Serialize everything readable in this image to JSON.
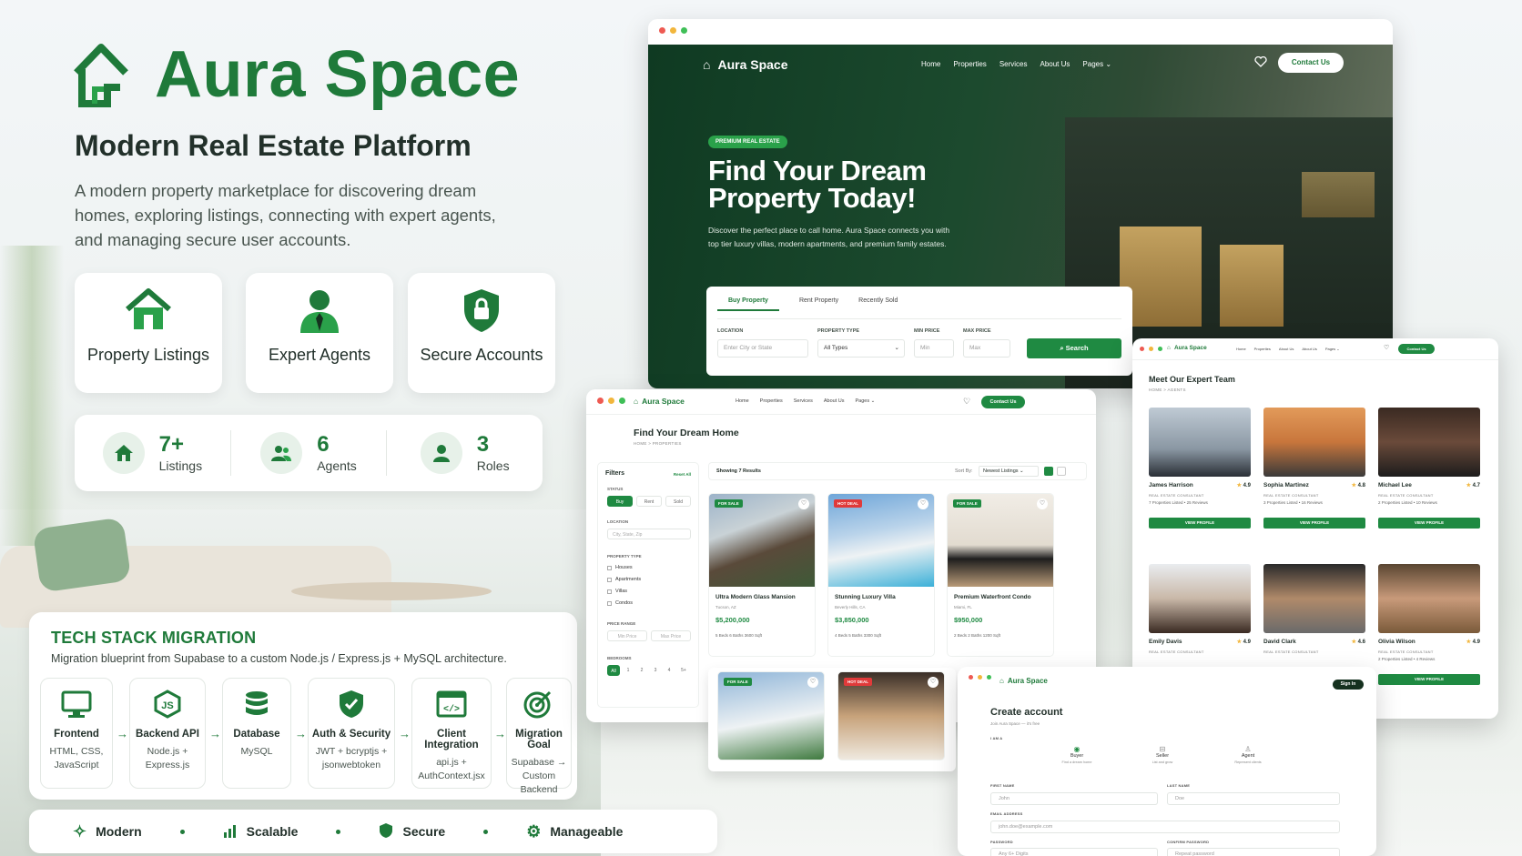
{
  "brand": {
    "name": "Aura Space",
    "tagline": "Modern Real Estate Platform",
    "description": "A modern property marketplace for discovering dream homes, exploring listings, connecting with expert agents, and managing secure user accounts.",
    "accent": "#1f7a3a"
  },
  "features": [
    {
      "label": "Property Listings",
      "icon": "house-icon"
    },
    {
      "label": "Expert Agents",
      "icon": "agent-icon"
    },
    {
      "label": "Secure Accounts",
      "icon": "shield-lock-icon"
    }
  ],
  "stats": [
    {
      "value": "7+",
      "label": "Listings",
      "icon": "home-icon"
    },
    {
      "value": "6",
      "label": "Agents",
      "icon": "users-icon"
    },
    {
      "value": "3",
      "label": "Roles",
      "icon": "user-icon"
    }
  ],
  "tech": {
    "title": "TECH STACK MIGRATION",
    "subtitle": "Migration blueprint from Supabase to a custom Node.js / Express.js + MySQL architecture.",
    "steps": [
      {
        "title": "Frontend",
        "desc": "HTML, CSS, JavaScript",
        "icon": "monitor-icon"
      },
      {
        "title": "Backend API",
        "desc": "Node.js + Express.js",
        "icon": "nodejs-icon"
      },
      {
        "title": "Database",
        "desc": "MySQL",
        "icon": "database-icon"
      },
      {
        "title": "Auth & Security",
        "desc": "JWT + bcryptjs + jsonwebtoken",
        "icon": "shield-icon"
      },
      {
        "title": "Client Integration",
        "desc": "api.js + AuthContext.jsx",
        "icon": "code-window-icon"
      },
      {
        "title": "Migration Goal",
        "desc": "Supabase → Custom Backend",
        "icon": "target-icon"
      }
    ]
  },
  "qualities": [
    "Modern",
    "Scalable",
    "Secure",
    "Manageable"
  ],
  "hero_window": {
    "brand": "Aura Space",
    "nav": [
      "Home",
      "Properties",
      "Services",
      "About Us",
      "Pages"
    ],
    "contact": "Contact Us",
    "badge": "PREMIUM REAL ESTATE",
    "headline": "Find Your Dream Property Today!",
    "text": "Discover the perfect place to call home. Aura Space connects you with top tier luxury villas, modern apartments, and premium family estates.",
    "tabs": [
      "Buy Property",
      "Rent Property",
      "Recently Sold"
    ],
    "fields": {
      "location_label": "LOCATION",
      "location_ph": "Enter City or State",
      "type_label": "PROPERTY TYPE",
      "type_value": "All Types",
      "min_label": "MIN PRICE",
      "min_ph": "Min",
      "max_label": "MAX PRICE",
      "max_ph": "Max"
    },
    "search": "Search"
  },
  "listing_window": {
    "brand": "Aura Space",
    "nav": [
      "Home",
      "Properties",
      "Services",
      "About Us",
      "Pages"
    ],
    "contact": "Contact Us",
    "title": "Find Your Dream Home",
    "crumb": "HOME  >  PROPERTIES",
    "filters": "Filters",
    "reset": "Reset All",
    "status_label": "STATUS",
    "status": [
      "Buy",
      "Rent",
      "Sold"
    ],
    "location_label": "LOCATION",
    "location_ph": "City, State, Zip",
    "type_label": "PROPERTY TYPE",
    "types": [
      "Houses",
      "Apartments",
      "Villas",
      "Condos"
    ],
    "price_label": "PRICE RANGE",
    "min_ph": "Min Price",
    "max_ph": "Max Price",
    "bed_label": "BEDROOMS",
    "beds": [
      "All",
      "1",
      "2",
      "3",
      "4",
      "5+"
    ],
    "results": "Showing 7 Results",
    "sort_label": "Sort By:",
    "sort_value": "Newest Listings",
    "cards": [
      {
        "tag": "FOR SALE",
        "name": "Ultra Modern Glass Mansion",
        "loc": "Tucson, AZ",
        "price": "$5,200,000",
        "feats": "5 Beds   6 Baths   3600 Sqft"
      },
      {
        "tag": "HOT DEAL",
        "name": "Stunning Luxury Villa",
        "loc": "Beverly Hills, CA",
        "price": "$3,850,000",
        "feats": "4 Beds   5 Baths   3300 Sqft"
      },
      {
        "tag": "FOR SALE",
        "name": "Premium Waterfront Condo",
        "loc": "Miami, FL",
        "price": "$950,000",
        "feats": "2 Beds   2 Baths   1200 Sqft"
      }
    ],
    "cards_row2": [
      {
        "tag": "FOR SALE"
      },
      {
        "tag": "HOT DEAL"
      }
    ]
  },
  "team_window": {
    "brand": "Aura Space",
    "nav": [
      "Home",
      "Properties",
      "About Us",
      "About Us",
      "Pages"
    ],
    "contact": "Contact Us",
    "title": "Meet Our Expert Team",
    "crumb": "HOME  >  AGENTS",
    "agents": [
      {
        "name": "James Harrison",
        "rating": "4.9",
        "role": "REAL ESTATE CONSULTANT",
        "listed": "7 Properties Listed • 25 Reviews",
        "btn": "VIEW PROFILE"
      },
      {
        "name": "Sophia Martinez",
        "rating": "4.8",
        "role": "REAL ESTATE CONSULTANT",
        "listed": "3 Properties Listed • 16 Reviews",
        "btn": "VIEW PROFILE"
      },
      {
        "name": "Michael Lee",
        "rating": "4.7",
        "role": "REAL ESTATE CONSULTANT",
        "listed": "2 Properties Listed • 10 Reviews",
        "btn": "VIEW PROFILE"
      },
      {
        "name": "Emily Davis",
        "rating": "4.9",
        "role": "REAL ESTATE CONSULTANT",
        "listed": "",
        "btn": ""
      },
      {
        "name": "David Clark",
        "rating": "4.6",
        "role": "REAL ESTATE CONSULTANT",
        "listed": "",
        "btn": ""
      },
      {
        "name": "Olivia Wilson",
        "rating": "4.9",
        "role": "REAL ESTATE CONSULTANT",
        "listed": "2 Properties Listed • 4 Reviews",
        "btn": "VIEW PROFILE"
      }
    ]
  },
  "signup_window": {
    "brand": "Aura Space",
    "signin": "Sign In",
    "title": "Create account",
    "sub": "Join Aura Space — it's free",
    "iam": "I AM A",
    "roles": [
      {
        "name": "Buyer",
        "desc": "Find a dream home"
      },
      {
        "name": "Seller",
        "desc": "List and grow"
      },
      {
        "name": "Agent",
        "desc": "Represent clients"
      }
    ],
    "first_label": "FIRST NAME",
    "first_ph": "John",
    "last_label": "LAST NAME",
    "last_ph": "Doe",
    "email_label": "EMAIL ADDRESS",
    "email_ph": "john.doe@example.com",
    "pw_label": "PASSWORD",
    "pw_ph": "Any 6+ Digits",
    "cpw_label": "CONFIRM PASSWORD",
    "cpw_ph": "Repeat password"
  }
}
